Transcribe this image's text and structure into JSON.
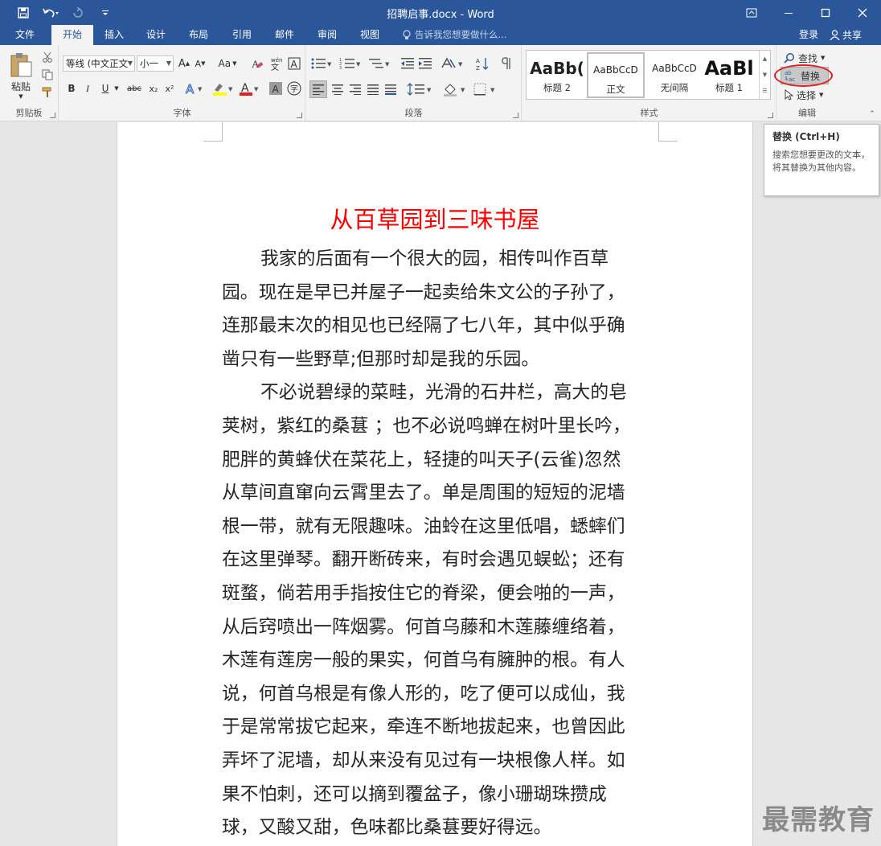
{
  "app": {
    "title": "招聘启事.docx - Word"
  },
  "tabs": {
    "file": "文件",
    "home": "开始",
    "insert": "插入",
    "design": "设计",
    "layout": "布局",
    "references": "引用",
    "mailings": "邮件",
    "review": "审阅",
    "view": "视图"
  },
  "tell_me": {
    "placeholder": "告诉我您想要做什么..."
  },
  "account": {
    "signin": "登录",
    "share": "共享"
  },
  "ribbon": {
    "clipboard": {
      "paste": "粘贴",
      "label": "剪贴板"
    },
    "font": {
      "font_name": "等线 (中文正文",
      "font_size": "小一",
      "grow": "A",
      "shrink": "A",
      "case": "Aa",
      "bold": "B",
      "italic": "I",
      "underline": "U",
      "strike": "abc",
      "subscript": "x₂",
      "superscript": "x²",
      "label": "字体"
    },
    "paragraph": {
      "label": "段落"
    },
    "styles": {
      "items": [
        {
          "sample": "AaBb(",
          "name": "标题 2"
        },
        {
          "sample": "AaBbCcD",
          "name": "正文"
        },
        {
          "sample": "AaBbCcD",
          "name": "无间隔"
        },
        {
          "sample": "AaBl",
          "name": "标题 1"
        }
      ],
      "label": "样式"
    },
    "editing": {
      "find": "查找",
      "replace": "替换",
      "select": "选择",
      "label": "编辑"
    }
  },
  "tooltip": {
    "title": "替换 (Ctrl+H)",
    "body": "搜索您想要更改的文本，将其替换为其他内容。"
  },
  "document": {
    "heading": "从百草园到三味书屋",
    "lines": [
      "我家的后面有一个很大的园，相传叫作百草",
      "园。现在是早已并屋子一起卖给朱文公的子孙了，",
      "连那最末次的相见也已经隔了七八年，其中似乎确",
      "凿只有一些野草;但那时却是我的乐园。",
      "不必说碧绿的菜畦，光滑的石井栏，高大的皂",
      "荚树，紫红的桑葚 ；也不必说鸣蝉在树叶里长吟，",
      "肥胖的黄蜂伏在菜花上，轻捷的叫天子(云雀)忽然",
      "从草间直窜向云霄里去了。单是周围的短短的泥墙",
      "根一带，就有无限趣味。油蛉在这里低唱，蟋蟀们",
      "在这里弹琴。翻开断砖来，有时会遇见蜈蚣；还有",
      "斑蝥，倘若用手指按住它的脊梁，便会啪的一声，",
      "从后窍喷出一阵烟雾。何首乌藤和木莲藤缠络着，",
      "木莲有莲房一般的果实，何首乌有臃肿的根。有人",
      "说，何首乌根是有像人形的，吃了便可以成仙，我",
      "于是常常拔它起来，牵连不断地拔起来，也曾因此",
      "弄坏了泥墙，却从来没有见过有一块根像人样。如",
      "果不怕刺，还可以摘到覆盆子，像小珊瑚珠攒成",
      "球，又酸又甜，色味都比桑葚要好得远。"
    ]
  },
  "watermark": "最需教育",
  "colors": {
    "accent": "#2b579a",
    "heading": "#ff0000",
    "highlight": "#e02020"
  }
}
